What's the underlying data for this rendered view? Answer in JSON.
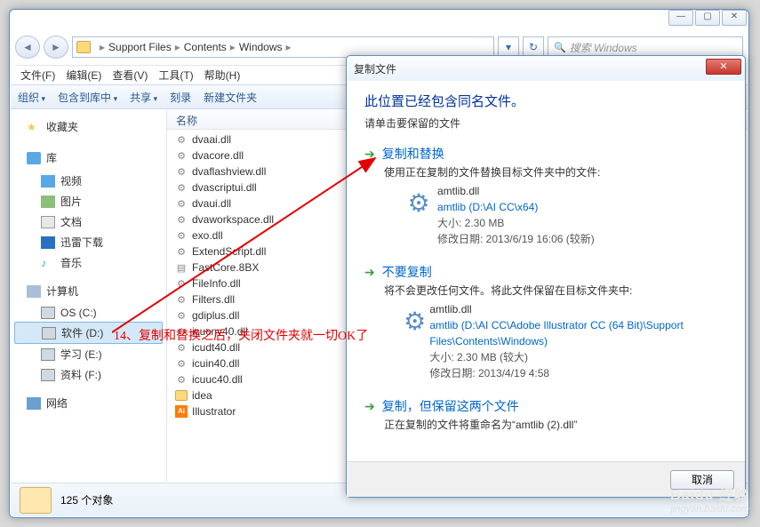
{
  "breadcrumb": {
    "p1": "Support Files",
    "p2": "Contents",
    "p3": "Windows"
  },
  "search": {
    "placeholder": "搜索 Windows"
  },
  "menu": {
    "file": "文件(F)",
    "edit": "编辑(E)",
    "view": "查看(V)",
    "tools": "工具(T)",
    "help": "帮助(H)"
  },
  "toolbar": {
    "org": "组织",
    "lib": "包含到库中",
    "share": "共享",
    "burn": "刻录",
    "newfolder": "新建文件夹"
  },
  "tree": {
    "fav": "收藏夹",
    "lib": "库",
    "video": "视频",
    "pic": "图片",
    "doc": "文档",
    "xunlei": "迅雷下载",
    "music": "音乐",
    "comp": "计算机",
    "c": "OS (C:)",
    "d": "软件 (D:)",
    "e": "学习 (E:)",
    "f": "资料 (F:)",
    "net": "网络"
  },
  "flabel": "名称",
  "files": [
    "dvaai.dll",
    "dvacore.dll",
    "dvaflashview.dll",
    "dvascriptui.dll",
    "dvaui.dll",
    "dvaworkspace.dll",
    "exo.dll",
    "ExtendScript.dll",
    "FastCore.8BX",
    "FileInfo.dll",
    "Filters.dll",
    "gdiplus.dll",
    "icucnv40.dll",
    "icudt40.dll",
    "icuin40.dll",
    "icuuc40.dll"
  ],
  "folders": {
    "idea": "idea",
    "illustrator": "Illustrator"
  },
  "status": {
    "count": "125 个对象"
  },
  "dialog": {
    "title": "复制文件",
    "h1": "此位置已经包含同名文件。",
    "sub": "请单击要保留的文件",
    "opt1": {
      "title": "复制和替换",
      "desc": "使用正在复制的文件替换目标文件夹中的文件:"
    },
    "file1": {
      "name": "amtlib.dll",
      "path": "amtlib (D:\\AI   CC\\x64)",
      "size": "大小: 2.30 MB",
      "date": "修改日期: 2013/6/19 16:06 (较新)"
    },
    "opt2": {
      "title": "不要复制",
      "desc": "将不会更改任何文件。将此文件保留在目标文件夹中:"
    },
    "file2": {
      "name": "amtlib.dll",
      "path": "amtlib (D:\\AI   CC\\Adobe Illustrator CC (64 Bit)\\Support Files\\Contents\\Windows)",
      "size": "大小: 2.30 MB (较大)",
      "date": "修改日期: 2013/4/19 4:58"
    },
    "opt3": {
      "title": "复制，但保留这两个文件",
      "desc": "正在复制的文件将重命名为“amtlib (2).dll”"
    },
    "cancel": "取消"
  },
  "annotation": "14、复制和替换之后，关闭文件夹就一切OK了",
  "watermark": {
    "brand": "Baidu 经验",
    "url": "jingyan.baidu.com"
  }
}
